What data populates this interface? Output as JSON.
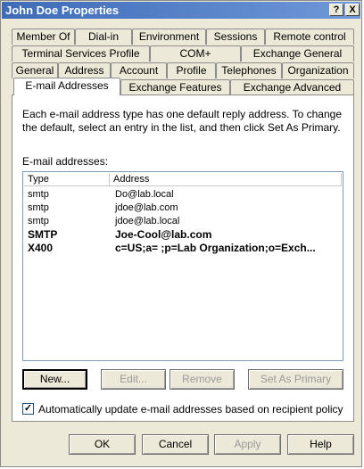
{
  "window": {
    "title": "John Doe Properties"
  },
  "title_buttons": {
    "help": "?",
    "close": "X"
  },
  "tabs_row1": [
    "Member Of",
    "Dial-in",
    "Environment",
    "Sessions",
    "Remote control"
  ],
  "tabs_row2": [
    "Terminal Services Profile",
    "COM+",
    "Exchange General"
  ],
  "tabs_row3": [
    "General",
    "Address",
    "Account",
    "Profile",
    "Telephones",
    "Organization"
  ],
  "tabs_row4": [
    "E-mail Addresses",
    "Exchange Features",
    "Exchange Advanced"
  ],
  "description": "Each e-mail address type has one default reply address. To change the default, select an entry in the list, and then click Set As Primary.",
  "list": {
    "label": "E-mail addresses:",
    "columns": [
      "Type",
      "Address"
    ],
    "rows": [
      {
        "type": "smtp",
        "address": "Do@lab.local",
        "primary": false
      },
      {
        "type": "smtp",
        "address": "jdoe@lab.com",
        "primary": false
      },
      {
        "type": "smtp",
        "address": "jdoe@lab.local",
        "primary": false
      },
      {
        "type": "SMTP",
        "address": "Joe-Cool@lab.com",
        "primary": true
      },
      {
        "type": "X400",
        "address": "c=US;a= ;p=Lab Organization;o=Exch...",
        "primary": true
      }
    ]
  },
  "buttons": {
    "new": "New...",
    "edit": "Edit...",
    "remove": "Remove",
    "set_primary": "Set As Primary"
  },
  "checkbox": {
    "label": "Automatically update e-mail addresses based on recipient policy",
    "checked": true
  },
  "footer": {
    "ok": "OK",
    "cancel": "Cancel",
    "apply": "Apply",
    "help": "Help"
  }
}
